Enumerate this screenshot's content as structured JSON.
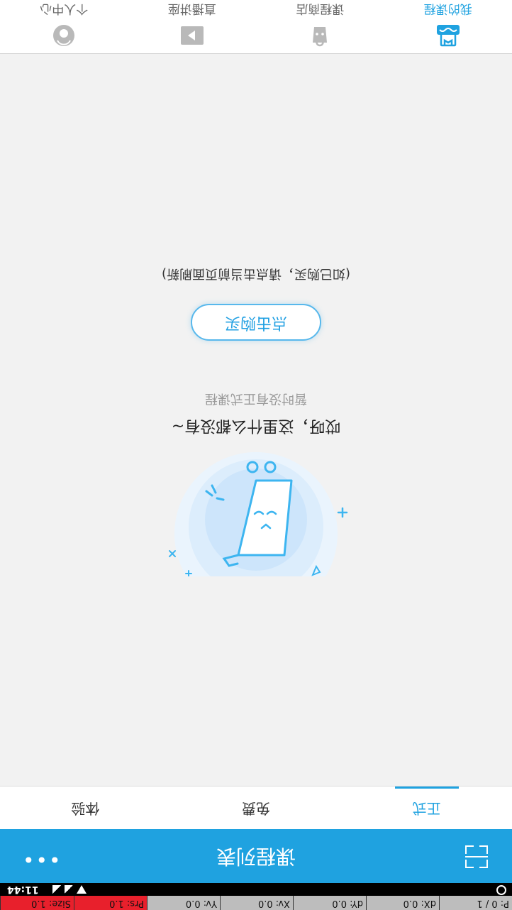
{
  "debug_bar": {
    "cells": [
      "P: 0 / 1",
      "dX: 0.0",
      "dY: 0.0",
      "Xv: 0.0",
      "Yv: 0.0",
      "Prs: 1.0",
      "Size: 1.0"
    ]
  },
  "status_bar": {
    "time": "11:44"
  },
  "header": {
    "title": "课程列表",
    "more_label": "•••"
  },
  "tabs": [
    {
      "label": "正式"
    },
    {
      "label": "免费"
    },
    {
      "label": "体验"
    }
  ],
  "empty_state": {
    "title": "哎呀，这里什么都没有~",
    "subtitle": "暂时没有正式课程",
    "button_label": "点击购买",
    "hint": "(如已购买，请点击当前页面刷新)"
  },
  "bottom_nav": [
    {
      "label": "我的课程",
      "icon": "my-courses-icon",
      "active": true
    },
    {
      "label": "课程商店",
      "icon": "shop-bag-icon",
      "active": false
    },
    {
      "label": "直播讲座",
      "icon": "live-play-icon",
      "active": false
    },
    {
      "label": "个人中心",
      "icon": "profile-icon",
      "active": false
    }
  ],
  "colors": {
    "accent": "#1fa2e0",
    "background": "#f2f2f2",
    "debug_red": "#e8202c"
  }
}
